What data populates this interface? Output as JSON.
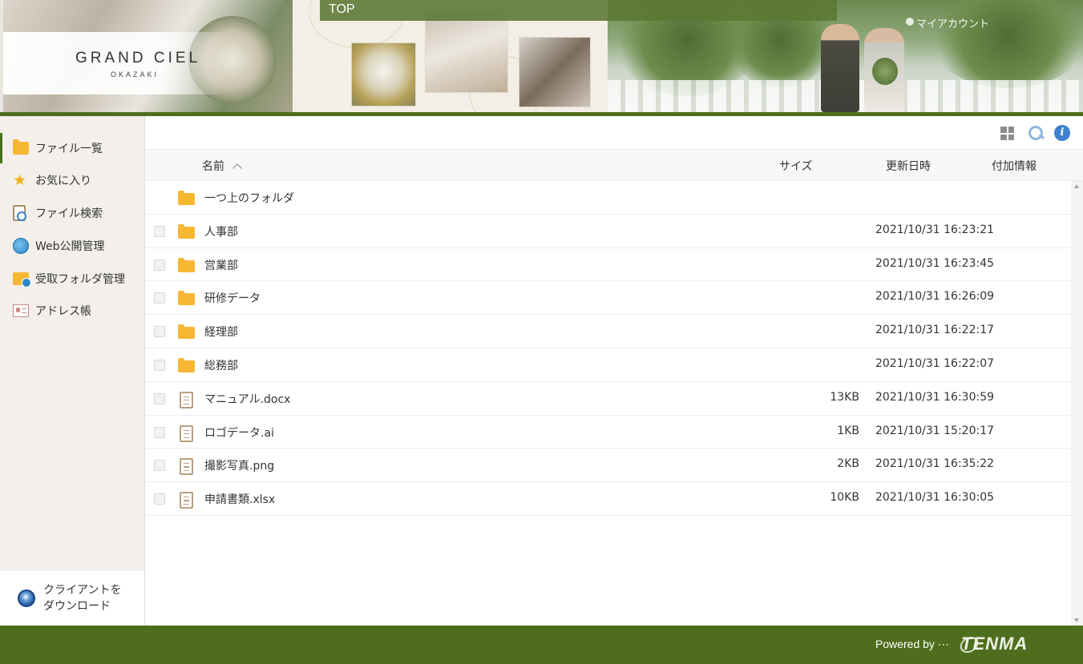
{
  "header": {
    "logo_main": "GRAND CIEL",
    "logo_sub": "OKAZAKI",
    "breadcrumb": "TOP",
    "account_label": "マイアカウント"
  },
  "sidebar": {
    "items": [
      {
        "label": "ファイル一覧",
        "icon": "folder-icon",
        "active": true
      },
      {
        "label": "お気に入り",
        "icon": "star-icon",
        "active": false
      },
      {
        "label": "ファイル検索",
        "icon": "file-search-icon",
        "active": false
      },
      {
        "label": "Web公開管理",
        "icon": "globe-icon",
        "active": false
      },
      {
        "label": "受取フォルダ管理",
        "icon": "receive-folder-icon",
        "active": false
      },
      {
        "label": "アドレス帳",
        "icon": "address-book-icon",
        "active": false
      }
    ],
    "download_label_line1": "クライアントを",
    "download_label_line2": "ダウンロード"
  },
  "table": {
    "headers": {
      "name": "名前",
      "size": "サイズ",
      "date": "更新日時",
      "extra": "付加情報"
    },
    "rows": [
      {
        "type": "parent",
        "name": "一つ上のフォルダ",
        "size": "",
        "date": ""
      },
      {
        "type": "folder",
        "name": "人事部",
        "size": "",
        "date": "2021/10/31 16:23:21"
      },
      {
        "type": "folder",
        "name": "営業部",
        "size": "",
        "date": "2021/10/31 16:23:45"
      },
      {
        "type": "folder",
        "name": "研修データ",
        "size": "",
        "date": "2021/10/31 16:26:09"
      },
      {
        "type": "folder",
        "name": "経理部",
        "size": "",
        "date": "2021/10/31 16:22:17"
      },
      {
        "type": "folder",
        "name": "総務部",
        "size": "",
        "date": "2021/10/31 16:22:07"
      },
      {
        "type": "file",
        "name": "マニュアル.docx",
        "size": "13KB",
        "date": "2021/10/31 16:30:59"
      },
      {
        "type": "file",
        "name": "ロゴデータ.ai",
        "size": "1KB",
        "date": "2021/10/31 15:20:17"
      },
      {
        "type": "file",
        "name": "撮影写真.png",
        "size": "2KB",
        "date": "2021/10/31 16:35:22"
      },
      {
        "type": "file",
        "name": "申請書類.xlsx",
        "size": "10KB",
        "date": "2021/10/31 16:30:05"
      }
    ]
  },
  "footer": {
    "powered_by": "Powered by ⋯",
    "brand": "TENMA"
  },
  "colors": {
    "accent_green": "#4f6e1d",
    "folder_yellow": "#f7b733",
    "info_blue": "#3e7fcf"
  }
}
